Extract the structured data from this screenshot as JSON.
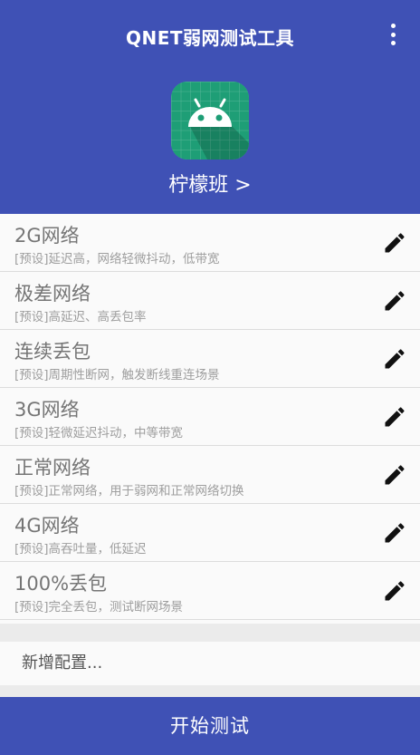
{
  "app": {
    "title": "QNET弱网测试工具",
    "icon_name": "android-icon",
    "group_link": "柠檬班 >",
    "accent": "#3f51b5",
    "icon_bg": "#3ddc84"
  },
  "profiles": [
    {
      "name": "2G网络",
      "desc": "[预设]延迟高，网络轻微抖动，低带宽"
    },
    {
      "name": "极差网络",
      "desc": "[预设]高延迟、高丢包率"
    },
    {
      "name": "连续丢包",
      "desc": "[预设]周期性断网，触发断线重连场景"
    },
    {
      "name": "3G网络",
      "desc": "[预设]轻微延迟抖动，中等带宽"
    },
    {
      "name": "正常网络",
      "desc": "[预设]正常网络，用于弱网和正常网络切换"
    },
    {
      "name": "4G网络",
      "desc": "[预设]高吞吐量，低延迟"
    },
    {
      "name": "100%丢包",
      "desc": "[预设]完全丢包，测试断网场景"
    }
  ],
  "add_config_label": "新增配置...",
  "start_button_label": "开始测试"
}
